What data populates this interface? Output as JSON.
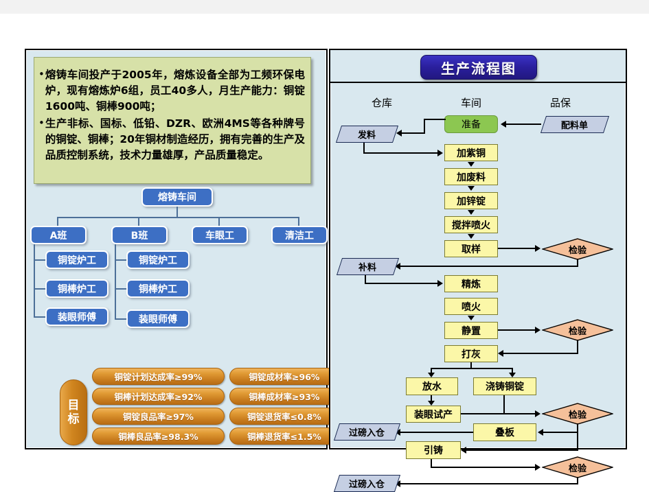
{
  "info": {
    "bullets": [
      "熔铸车间投产于2005年，熔炼设备全部为工频环保电炉，现有熔炼炉6组，员工40多人，月生产能力：铜锭1600吨、铜棒900吨；",
      "生产非标、国标、低铅、DZR、欧洲4MS等各种牌号的铜锭、铜棒；20年铜材制造经历，拥有完善的生产及品质控制系统，技术力量雄厚，产品质量稳定。"
    ]
  },
  "org": {
    "root": "熔铸车间",
    "level2": [
      "A班",
      "B班",
      "车眼工",
      "清洁工"
    ],
    "a_children": [
      "铜锭炉工",
      "铜棒炉工",
      "装眼师傅"
    ],
    "b_children": [
      "铜锭炉工",
      "铜棒炉工",
      "装眼师傅"
    ]
  },
  "goals": {
    "badge": "目标",
    "badge_chars": [
      "目",
      "标"
    ],
    "left_column": [
      "铜锭计划达成率≥99%",
      "铜棒计划达成率≥92%",
      "铜锭良品率≥97%",
      "铜棒良品率≥98.3%"
    ],
    "right_column": [
      "铜锭成材率≥96%",
      "铜棒成材率≥93%",
      "铜锭退货率≤0.8%",
      "铜棒退货率≤1.5%"
    ]
  },
  "flow": {
    "title": "生产流程图",
    "columns": [
      "仓库",
      "车间",
      "品保"
    ],
    "nodes": {
      "prepare": "准备",
      "recipe": "配料单",
      "issue": "发料",
      "add_copper": "加紫铜",
      "add_scrap": "加废料",
      "add_zinc": "加锌锭",
      "stir_fire": "搅拌喷火",
      "sample": "取样",
      "replenish": "补料",
      "refine": "精炼",
      "fire": "喷火",
      "settle": "静置",
      "ash": "打灰",
      "water": "放水",
      "cast_ingot": "浇铸铜锭",
      "trial": "装眼试产",
      "stack": "叠板",
      "draw_cast": "引铸",
      "weigh_in_1": "过磅入仓",
      "weigh_in_2": "过磅入仓",
      "inspect_1": "检验",
      "inspect_2": "检验",
      "inspect_3": "检验",
      "inspect_4": "检验"
    }
  },
  "colors": {
    "panel_bg": "#d9e8ef",
    "info_bg": "#d7e1a8",
    "org_blue": "#3d6fc4",
    "goal_orange": "#d0851f",
    "flow_yellow": "#fbf7a8",
    "flow_green": "#8cc751",
    "flow_peach": "#f5c09a",
    "flow_para": "#c5cfe3",
    "title_navy": "#2a1f9e"
  }
}
